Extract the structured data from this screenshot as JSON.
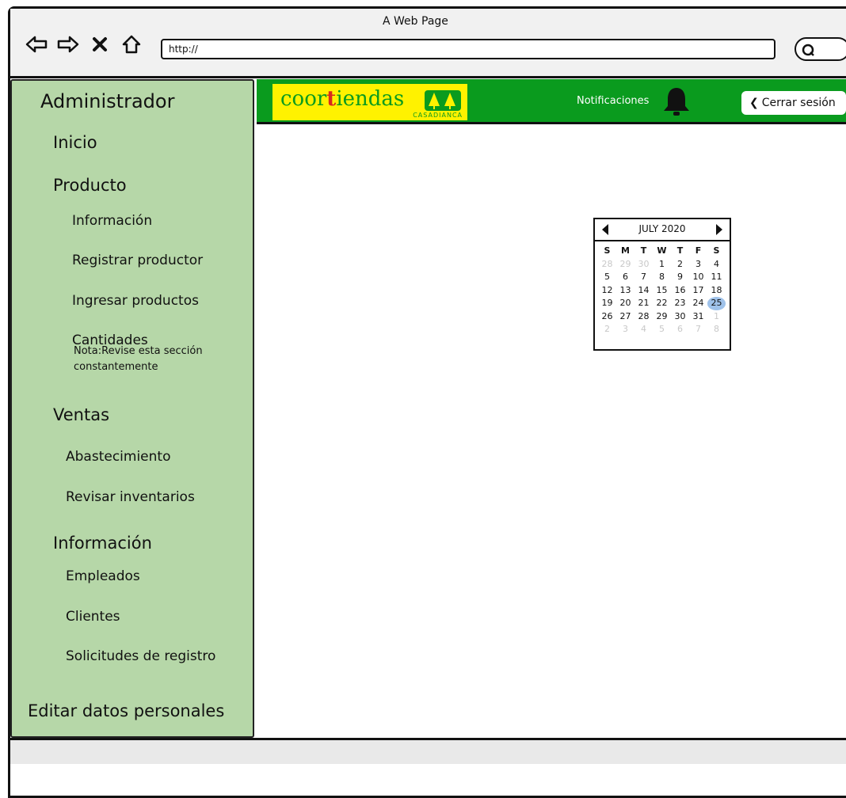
{
  "window": {
    "title": "A Web Page"
  },
  "browser": {
    "url": "http://"
  },
  "header": {
    "logo": {
      "part1": "coor",
      "part2": "t",
      "part3": "iendas",
      "subtitle": "CASADIANCA"
    },
    "notifications_label": "Notificaciones",
    "logout_label": "Cerrar sesión"
  },
  "sidebar": {
    "title": "Administrador",
    "inicio": "Inicio",
    "producto": "Producto",
    "informacion_producto": "Información",
    "registrar_productor": "Registrar productor",
    "ingresar_productos": "Ingresar productos",
    "cantidades": "Cantidades",
    "cantidades_note": "Nota:Revise esta sección constantemente",
    "ventas": "Ventas",
    "abastecimiento": "Abastecimiento",
    "revisar_inventarios": "Revisar inventarios",
    "informacion": "Información",
    "empleados": "Empleados",
    "clientes": "Clientes",
    "solicitudes": "Solicitudes de registro",
    "editar_datos": "Editar datos personales"
  },
  "calendar": {
    "month_label": "JULY 2020",
    "weekdays": [
      "S",
      "M",
      "T",
      "W",
      "T",
      "F",
      "S"
    ],
    "days": [
      {
        "d": "28",
        "muted": true
      },
      {
        "d": "29",
        "muted": true
      },
      {
        "d": "30",
        "muted": true
      },
      {
        "d": "1"
      },
      {
        "d": "2"
      },
      {
        "d": "3"
      },
      {
        "d": "4"
      },
      {
        "d": "5"
      },
      {
        "d": "6"
      },
      {
        "d": "7"
      },
      {
        "d": "8"
      },
      {
        "d": "9"
      },
      {
        "d": "10"
      },
      {
        "d": "11"
      },
      {
        "d": "12"
      },
      {
        "d": "13"
      },
      {
        "d": "14"
      },
      {
        "d": "15"
      },
      {
        "d": "16"
      },
      {
        "d": "17"
      },
      {
        "d": "18"
      },
      {
        "d": "19"
      },
      {
        "d": "20"
      },
      {
        "d": "21"
      },
      {
        "d": "22"
      },
      {
        "d": "23"
      },
      {
        "d": "24"
      },
      {
        "d": "25",
        "selected": true
      },
      {
        "d": "26"
      },
      {
        "d": "27"
      },
      {
        "d": "28"
      },
      {
        "d": "29"
      },
      {
        "d": "30"
      },
      {
        "d": "31"
      },
      {
        "d": "1",
        "muted": true
      },
      {
        "d": "2",
        "muted": true
      },
      {
        "d": "3",
        "muted": true
      },
      {
        "d": "4",
        "muted": true
      },
      {
        "d": "5",
        "muted": true
      },
      {
        "d": "6",
        "muted": true
      },
      {
        "d": "7",
        "muted": true
      },
      {
        "d": "8",
        "muted": true
      }
    ]
  },
  "colors": {
    "sidebar_bg": "#b6d7a8",
    "header_bg": "#0a9b1e",
    "logo_bg": "#fff200",
    "selected_day": "#9fc2ea"
  },
  "icons": {
    "back": "arrow-left-icon",
    "forward": "arrow-right-icon",
    "stop": "x-icon",
    "home": "home-icon",
    "search": "search-icon",
    "bell": "bell-icon",
    "chevron": "chevron-left-icon"
  }
}
